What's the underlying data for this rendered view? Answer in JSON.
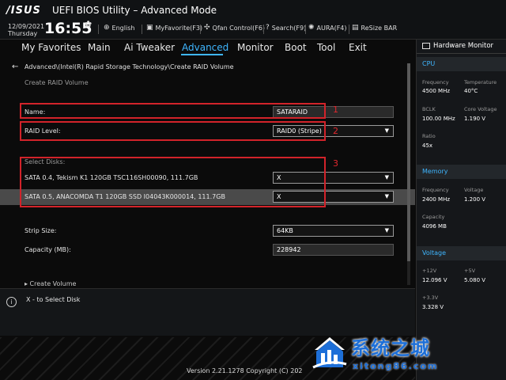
{
  "header": {
    "logo": "/ISUS",
    "title": "UEFI BIOS Utility – Advanced Mode",
    "date": "12/09/2021",
    "day": "Thursday",
    "time": "16:55",
    "tools": [
      {
        "icon": "globe-icon",
        "label": "English"
      },
      {
        "icon": "favorite-icon",
        "label": "MyFavorite(F3)"
      },
      {
        "icon": "fan-icon",
        "label": "Qfan Control(F6)"
      },
      {
        "icon": "search-icon",
        "label": "Search(F9)"
      },
      {
        "icon": "aura-icon",
        "label": "AURA(F4)"
      },
      {
        "icon": "resize-bar-icon",
        "label": "ReSize BAR"
      }
    ]
  },
  "menu": [
    "My Favorites",
    "Main",
    "Ai Tweaker",
    "Advanced",
    "Monitor",
    "Boot",
    "Tool",
    "Exit"
  ],
  "menu_active": "Advanced",
  "main": {
    "breadcrumb": "Advanced\\(Intel(R) Rapid Storage Technology\\Create RAID Volume",
    "subtitle": "Create RAID Volume",
    "name_label": "Name:",
    "name_value": "SATARAID",
    "raid_label": "RAID Level:",
    "raid_value": "RAID0 (Stripe)",
    "select_disks_label": "Select Disks:",
    "disks": [
      {
        "label": "SATA 0.4, Tekism K1 120GB TSC116SH00090, 111.7GB",
        "value": "X"
      },
      {
        "label": "SATA 0.5, ANACOMDA T1 120GB SSD I04043K000014, 111.7GB",
        "value": "X"
      }
    ],
    "strip_label": "Strip Size:",
    "strip_value": "64KB",
    "capacity_label": "Capacity (MB):",
    "capacity_value": "228942",
    "cut_item": "▸ Create Volume",
    "annotations": [
      "1",
      "2",
      "3"
    ]
  },
  "help": {
    "text": "X - to Select Disk"
  },
  "footer": {
    "version": "Version 2.21.1278 Copyright (C) 202"
  },
  "hw": {
    "title": "Hardware Monitor",
    "cpu": {
      "title": "CPU",
      "frequency_k": "Frequency",
      "frequency_v": "4500 MHz",
      "temperature_k": "Temperature",
      "temperature_v": "40°C",
      "bclk_k": "BCLK",
      "bclk_v": "100.00 MHz",
      "corev_k": "Core Voltage",
      "corev_v": "1.190 V",
      "ratio_k": "Ratio",
      "ratio_v": "45x"
    },
    "memory": {
      "title": "Memory",
      "frequency_k": "Frequency",
      "frequency_v": "2400 MHz",
      "voltage_k": "Voltage",
      "voltage_v": "1.200 V",
      "capacity_k": "Capacity",
      "capacity_v": "4096 MB"
    },
    "voltage": {
      "title": "Voltage",
      "v12_k": "+12V",
      "v12_v": "12.096 V",
      "v5_k": "+5V",
      "v5_v": "5.080 V",
      "v33_k": "+3.3V",
      "v33_v": "3.328 V"
    }
  },
  "watermark": {
    "cn": "系统之城",
    "en": "xitong86.com"
  },
  "colors": {
    "accent": "#3fb6ff",
    "annotation": "#d2232a",
    "watermark": "#1d6fd8"
  }
}
